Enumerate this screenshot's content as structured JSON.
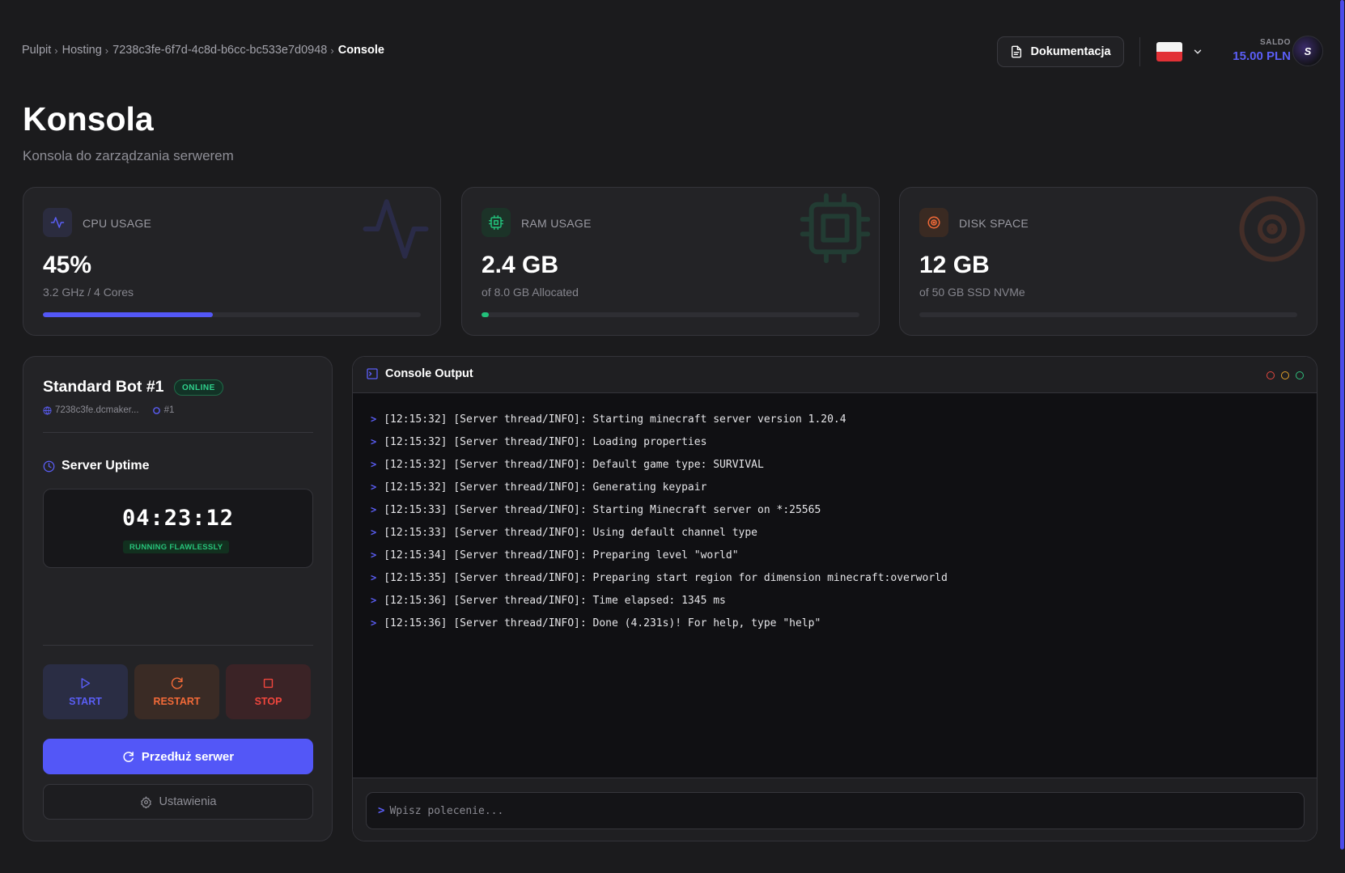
{
  "breadcrumb": {
    "items": [
      "Pulpit",
      "Hosting",
      "7238c3fe-6f7d-4c8d-b6cc-bc533e7d0948"
    ],
    "current": "Console"
  },
  "header": {
    "docs_label": "Dokumentacja",
    "language": "PL",
    "balance_label": "SALDO",
    "balance_value": "15.00 PLN",
    "avatar_text": "S"
  },
  "page": {
    "title": "Konsola",
    "subtitle": "Konsola do zarządzania serwerem"
  },
  "stats": {
    "cpu": {
      "label": "CPU USAGE",
      "value": "45%",
      "sub": "3.2 GHz / 4 Cores",
      "progress": 0.45,
      "color": "#5357f7"
    },
    "ram": {
      "label": "RAM USAGE",
      "value": "2.4 GB",
      "sub": "of 8.0 GB Allocated",
      "progress": 0.02,
      "color": "#22c07a"
    },
    "disk": {
      "label": "DISK SPACE",
      "value": "12 GB",
      "sub": "of 50 GB SSD NVMe",
      "progress": 0.0,
      "color": "#f26a38"
    }
  },
  "server": {
    "name": "Standard Bot #1",
    "status": "ONLINE",
    "host": "7238c3fe.dcmaker...",
    "id": "#1",
    "uptime_title": "Server Uptime",
    "uptime": "04:23:12",
    "uptime_status": "RUNNING FLAWLESSLY",
    "start_label": "START",
    "restart_label": "RESTART",
    "stop_label": "STOP",
    "extend_label": "Przedłuż serwer",
    "settings_label": "Ustawienia"
  },
  "console": {
    "title": "Console Output",
    "lines": [
      "[12:15:32] [Server thread/INFO]: Starting minecraft server version 1.20.4",
      "[12:15:32] [Server thread/INFO]: Loading properties",
      "[12:15:32] [Server thread/INFO]: Default game type: SURVIVAL",
      "[12:15:32] [Server thread/INFO]: Generating keypair",
      "[12:15:33] [Server thread/INFO]: Starting Minecraft server on *:25565",
      "[12:15:33] [Server thread/INFO]: Using default channel type",
      "[12:15:34] [Server thread/INFO]: Preparing level \"world\"",
      "[12:15:35] [Server thread/INFO]: Preparing start region for dimension minecraft:overworld",
      "[12:15:36] [Server thread/INFO]: Time elapsed: 1345 ms",
      "[12:15:36] [Server thread/INFO]: Done (4.231s)! For help, type \"help\""
    ],
    "prompt": ">",
    "input_value": "",
    "input_placeholder": "Wpisz polecenie..."
  }
}
